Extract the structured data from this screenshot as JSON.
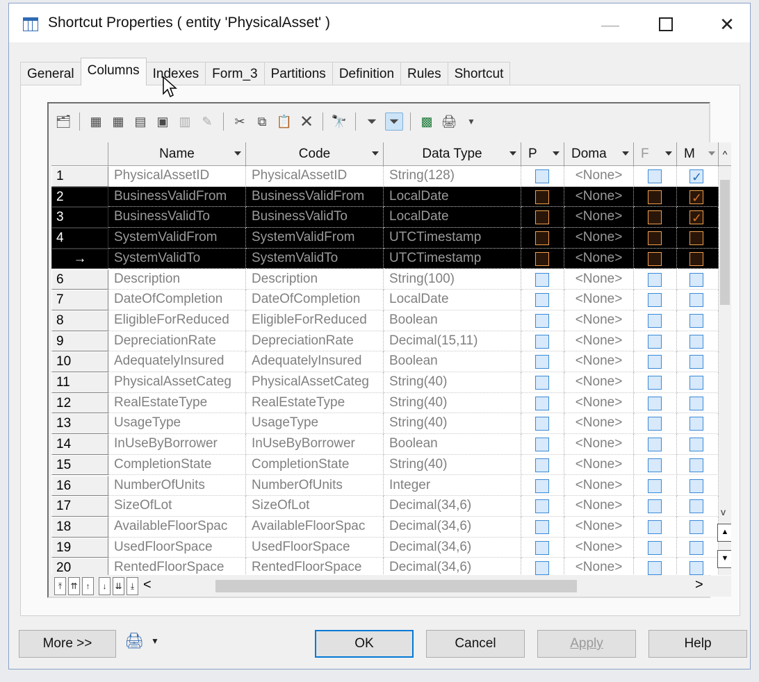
{
  "window": {
    "title": "Shortcut Properties ( entity 'PhysicalAsset' )"
  },
  "tabs": [
    "General",
    "Columns",
    "Indexes",
    "Form_3",
    "Partitions",
    "Definition",
    "Rules",
    "Shortcut"
  ],
  "active_tab": "Columns",
  "columns": [
    "Name",
    "Code",
    "Data Type",
    "P",
    "Doma",
    "F",
    "M"
  ],
  "rows": [
    {
      "num": "1",
      "name": "PhysicalAssetID",
      "code": "PhysicalAssetID",
      "type": "String(128)",
      "domain": "<None>",
      "m": true,
      "selected": false
    },
    {
      "num": "2",
      "name": "BusinessValidFrom",
      "code": "BusinessValidFrom",
      "type": "LocalDate",
      "domain": "<None>",
      "m": true,
      "selected": true
    },
    {
      "num": "3",
      "name": "BusinessValidTo",
      "code": "BusinessValidTo",
      "type": "LocalDate",
      "domain": "<None>",
      "m": true,
      "selected": true
    },
    {
      "num": "4",
      "name": "SystemValidFrom",
      "code": "SystemValidFrom",
      "type": "UTCTimestamp",
      "domain": "<None>",
      "m": false,
      "selected": true
    },
    {
      "num": "→",
      "name": "SystemValidTo",
      "code": "SystemValidTo",
      "type": "UTCTimestamp",
      "domain": "<None>",
      "m": false,
      "selected": true
    },
    {
      "num": "6",
      "name": "Description",
      "code": "Description",
      "type": "String(100)",
      "domain": "<None>",
      "m": false,
      "selected": false
    },
    {
      "num": "7",
      "name": "DateOfCompletion",
      "code": "DateOfCompletion",
      "type": "LocalDate",
      "domain": "<None>",
      "m": false,
      "selected": false
    },
    {
      "num": "8",
      "name": "EligibleForReduced",
      "code": "EligibleForReduced",
      "type": "Boolean",
      "domain": "<None>",
      "m": false,
      "selected": false
    },
    {
      "num": "9",
      "name": "DepreciationRate",
      "code": "DepreciationRate",
      "type": "Decimal(15,11)",
      "domain": "<None>",
      "m": false,
      "selected": false
    },
    {
      "num": "10",
      "name": "AdequatelyInsured",
      "code": "AdequatelyInsured",
      "type": "Boolean",
      "domain": "<None>",
      "m": false,
      "selected": false
    },
    {
      "num": "11",
      "name": "PhysicalAssetCateg",
      "code": "PhysicalAssetCateg",
      "type": "String(40)",
      "domain": "<None>",
      "m": false,
      "selected": false
    },
    {
      "num": "12",
      "name": "RealEstateType",
      "code": "RealEstateType",
      "type": "String(40)",
      "domain": "<None>",
      "m": false,
      "selected": false
    },
    {
      "num": "13",
      "name": "UsageType",
      "code": "UsageType",
      "type": "String(40)",
      "domain": "<None>",
      "m": false,
      "selected": false
    },
    {
      "num": "14",
      "name": "InUseByBorrower",
      "code": "InUseByBorrower",
      "type": "Boolean",
      "domain": "<None>",
      "m": false,
      "selected": false
    },
    {
      "num": "15",
      "name": "CompletionState",
      "code": "CompletionState",
      "type": "String(40)",
      "domain": "<None>",
      "m": false,
      "selected": false
    },
    {
      "num": "16",
      "name": "NumberOfUnits",
      "code": "NumberOfUnits",
      "type": "Integer",
      "domain": "<None>",
      "m": false,
      "selected": false
    },
    {
      "num": "17",
      "name": "SizeOfLot",
      "code": "SizeOfLot",
      "type": "Decimal(34,6)",
      "domain": "<None>",
      "m": false,
      "selected": false
    },
    {
      "num": "18",
      "name": "AvailableFloorSpac",
      "code": "AvailableFloorSpac",
      "type": "Decimal(34,6)",
      "domain": "<None>",
      "m": false,
      "selected": false
    },
    {
      "num": "19",
      "name": "UsedFloorSpace",
      "code": "UsedFloorSpace",
      "type": "Decimal(34,6)",
      "domain": "<None>",
      "m": false,
      "selected": false
    },
    {
      "num": "20",
      "name": "RentedFloorSpace",
      "code": "RentedFloorSpace",
      "type": "Decimal(34,6)",
      "domain": "<None>",
      "m": false,
      "selected": false
    }
  ],
  "buttons": {
    "more": "More >>",
    "ok": "OK",
    "cancel": "Cancel",
    "apply": "Apply",
    "help": "Help"
  },
  "colors": {
    "selection": "#000000",
    "accent": "#0078d7",
    "checkbox": "#3b89d6"
  }
}
